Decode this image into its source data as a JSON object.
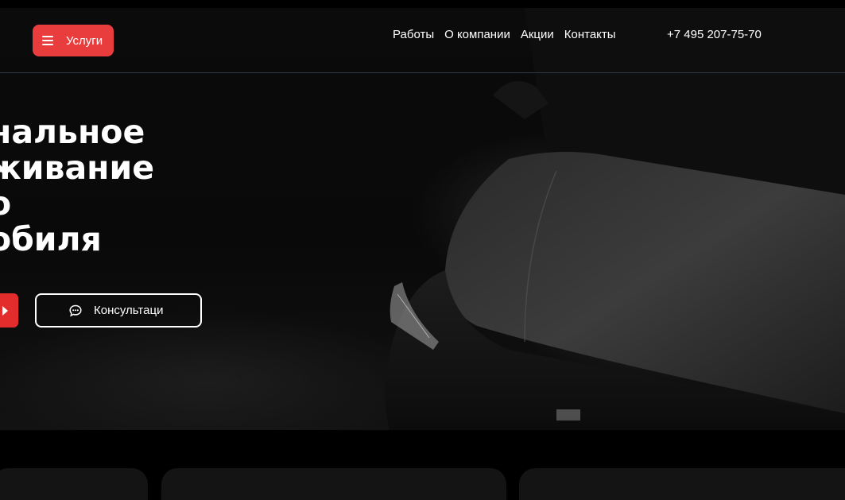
{
  "header": {
    "services_label": "Услуги",
    "nav": [
      "Работы",
      "О компании",
      "Акции",
      "Контакты"
    ],
    "phone": "+7 495 207-75-70"
  },
  "hero": {
    "headline_lines": [
      "нальное",
      "живание",
      "о",
      "обиля"
    ],
    "consult_label": "Консультаци"
  },
  "icons": {
    "menu": "hamburger-icon",
    "chat": "chat-bubble-icon",
    "arrow": "arrow-right-icon"
  },
  "colors": {
    "accent": "#e93d3d",
    "background": "#000000",
    "header_divider": "#2d3944"
  }
}
